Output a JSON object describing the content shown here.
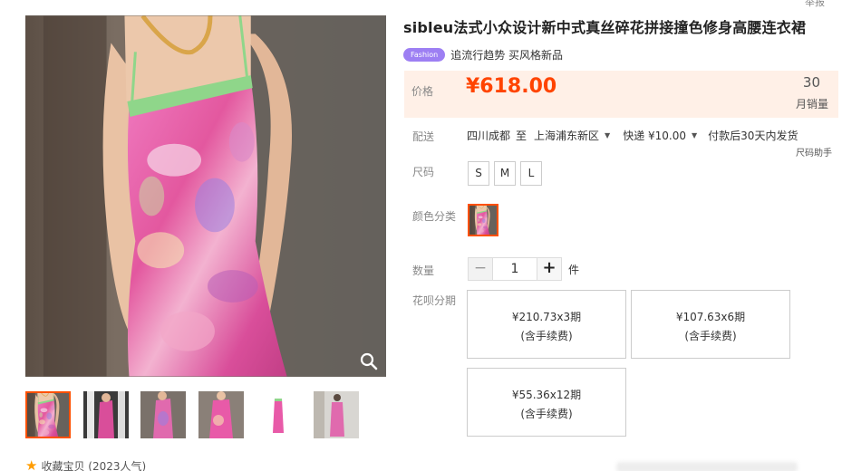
{
  "product": {
    "title": "sibleu法式小众设计新中式真丝碎花拼接撞色修身高腰连衣裙",
    "badge": "Fashion",
    "tagline": "追流行趋势 买风格新品",
    "corner_text": "举报"
  },
  "price": {
    "label": "价格",
    "value": "¥618.00",
    "monthly_sales": "30",
    "monthly_sales_label": "月销量"
  },
  "shipping": {
    "label": "配送",
    "from": "四川成都",
    "to_word": "至",
    "to": "上海浦东新区",
    "method": "快递 ¥10.00",
    "note": "付款后30天内发货",
    "size_helper": "尺码助手"
  },
  "size": {
    "label": "尺码",
    "options": [
      "S",
      "M",
      "L"
    ]
  },
  "color": {
    "label": "颜色分类"
  },
  "quantity": {
    "label": "数量",
    "minus": "−",
    "value": "1",
    "plus": "+",
    "unit": "件"
  },
  "installments": {
    "label": "花呗分期",
    "options": [
      {
        "amount": "¥210.73x3期",
        "fee": "(含手续费)"
      },
      {
        "amount": "¥107.63x6期",
        "fee": "(含手续费)"
      },
      {
        "amount": "¥55.36x12期",
        "fee": "(含手续费)"
      }
    ]
  },
  "favorites": {
    "text": "收藏宝贝 (2023人气)"
  },
  "gallery": {
    "thumb_count": 6,
    "selected_index": 0
  },
  "colors": {
    "accent": "#ff5000",
    "price": "#ff4400",
    "price_bg": "#fff0e7",
    "badge": "#9d7ff3",
    "dress_pink": "#e85aa8",
    "trim_green": "#8fd68a"
  },
  "icons": {
    "zoom": "magnifier-icon",
    "favorite": "star-icon",
    "dropdown": "caret-down-icon"
  }
}
